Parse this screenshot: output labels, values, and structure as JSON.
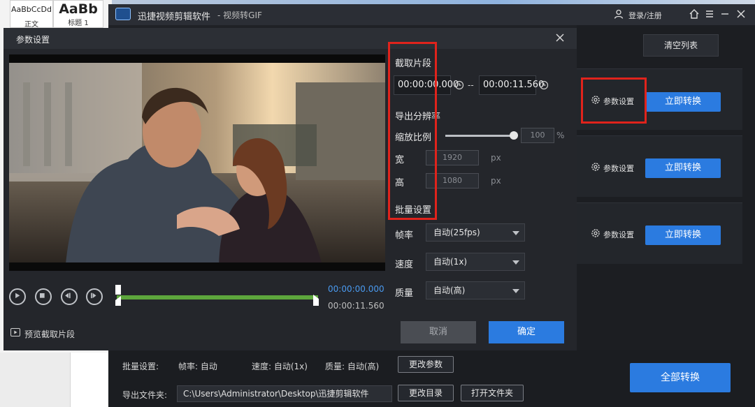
{
  "word": {
    "style1_sample": "AaBbCcDd",
    "style1_name": "正文",
    "style2_sample": "AaBb",
    "style2_name": "标题 1"
  },
  "app": {
    "title": "迅捷视频剪辑软件",
    "subtitle": "- 视频转GIF",
    "login_label": "登录/注册",
    "clear_list": "清空列表",
    "items": [
      {
        "settings_label": "参数设置",
        "convert_label": "立即转换"
      },
      {
        "settings_label": "参数设置",
        "convert_label": "立即转换"
      },
      {
        "settings_label": "参数设置",
        "convert_label": "立即转换"
      }
    ],
    "bottom": {
      "batch_label": "批量设置:",
      "fps_label": "帧率: 自动",
      "speed_label": "速度: 自动(1x)",
      "quality_label": "质量: 自动(高)",
      "change_params": "更改参数",
      "output_label": "导出文件夹:",
      "output_path": "C:\\Users\\Administrator\\Desktop\\迅捷剪辑软件",
      "change_dir": "更改目录",
      "open_folder": "打开文件夹",
      "convert_all": "全部转换"
    }
  },
  "dialog": {
    "title": "参数设置",
    "clip_section": "截取片段",
    "start_time": "00:00:00.000",
    "time_separator": "--",
    "end_time": "00:00:11.560",
    "resolution_section": "导出分辨率",
    "scale_label": "缩放比例",
    "scale_value": "100",
    "scale_fraction": 1.0,
    "percent": "%",
    "width_label": "宽",
    "width_value": "1920",
    "height_label": "高",
    "height_value": "1080",
    "px": "px",
    "batch_section": "批量设置",
    "fps_label": "帧率",
    "fps_value": "自动(25fps)",
    "speed_label": "速度",
    "speed_value": "自动(1x)",
    "quality_label": "质量",
    "quality_value": "自动(高)",
    "current_time": "00:00:00.000",
    "total_time": "00:00:11.560",
    "preview_label": "预览截取片段",
    "cancel": "取消",
    "ok": "确定"
  },
  "colors": {
    "accent": "#2b7be0",
    "highlight_box": "#e0231c",
    "timeline": "#5da63c"
  }
}
